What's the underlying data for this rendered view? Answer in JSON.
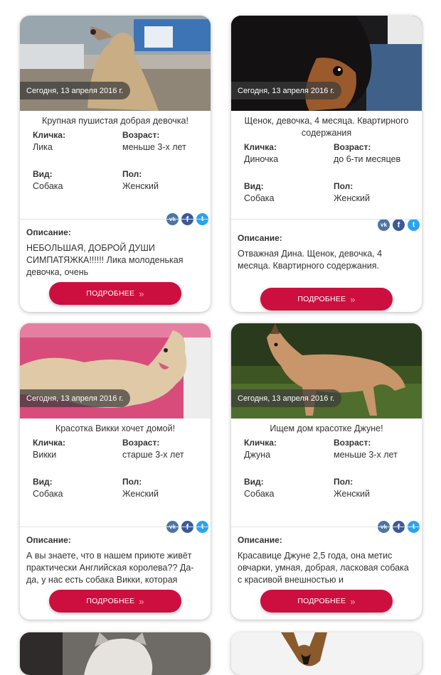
{
  "cards": [
    {
      "date": "Сегодня, 13 апреля 2016 г.",
      "headline": "Крупная пушистая добрая девочка!",
      "name_label": "Кличка:",
      "name": "Лика",
      "age_label": "Возраст:",
      "age": "меньше 3-х лет",
      "type_label": "Вид:",
      "type": "Собака",
      "sex_label": "Пол:",
      "sex": "Женский",
      "desc_label": "Описание:",
      "desc": "НЕБОЛЬШАЯ, ДОБРОЙ ДУШИ СИМПАТЯЖКА!!!!!! Лика молоденькая девочка, очень",
      "button": "ПОДРОБНЕЕ"
    },
    {
      "date": "Сегодня, 13 апреля 2016 г.",
      "headline": "Щенок, девочка, 4 месяца. Квартирного содержания",
      "name_label": "Кличка:",
      "name": "Диночка",
      "age_label": "Возраст:",
      "age": "до 6-ти месяцев",
      "type_label": "Вид:",
      "type": "Собака",
      "sex_label": "Пол:",
      "sex": "Женский",
      "desc_label": "Описание:",
      "desc": "Отважная Дина. Щенок, девочка, 4 месяца. Квартирного содержания.",
      "button": "ПОДРОБНЕЕ"
    },
    {
      "date": "Сегодня, 13 апреля 2016 г.",
      "headline": "Красотка Викки хочет домой!",
      "name_label": "Кличка:",
      "name": "Викки",
      "age_label": "Возраст:",
      "age": "старше 3-х лет",
      "type_label": "Вид:",
      "type": "Собака",
      "sex_label": "Пол:",
      "sex": "Женский",
      "desc_label": "Описание:",
      "desc": "А вы знаете, что в нашем приюте живёт практически Английская королева?? Да-да, у нас есть собака Викки, которая",
      "button": "ПОДРОБНЕЕ"
    },
    {
      "date": "Сегодня, 13 апреля 2016 г.",
      "headline": "Ищем дом красотке Джуне!",
      "name_label": "Кличка:",
      "name": "Джуна",
      "age_label": "Возраст:",
      "age": "меньше 3-х лет",
      "type_label": "Вид:",
      "type": "Собака",
      "sex_label": "Пол:",
      "sex": "Женский",
      "desc_label": "Описание:",
      "desc": "Красавице Джуне 2,5 года, она метис овчарки, умная, добрая, ласковая собака с красивой внешностью и",
      "button": "ПОДРОБНЕЕ"
    }
  ],
  "social_icons": [
    "vk-icon",
    "facebook-icon",
    "twitter-icon"
  ],
  "colors": {
    "button": "#cc0f3f",
    "vk": "#4c75a3",
    "facebook": "#3b5998",
    "twitter": "#2aa3ef"
  }
}
